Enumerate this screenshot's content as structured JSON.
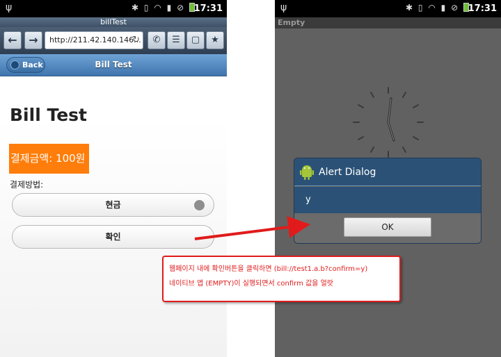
{
  "left_phone": {
    "status": {
      "time": "17:31"
    },
    "window_title": "billTest",
    "browser": {
      "url": "http://211.42.140.146..."
    },
    "header": {
      "back_label": "Back",
      "title": "Bill Test"
    },
    "page": {
      "heading": "Bill Test",
      "amount_label": "결제금액: 100원",
      "method_label": "결제방법:",
      "method_option": "현금",
      "confirm_label": "확인"
    }
  },
  "right_phone": {
    "status": {
      "time": "17:31"
    },
    "app_title": "Empty",
    "dialog": {
      "title": "Alert Dialog",
      "message": "y",
      "ok_label": "OK"
    }
  },
  "annotation": {
    "line1": "웹페이지 내에 확인버튼을 클릭하면 (bill://test1.a.b?confirm=y)",
    "line2": "네이티브 앱 (EMPTY)이 실행되면서 confirm 값을 얼랏"
  },
  "colors": {
    "amount_bg": "#ff7d0a",
    "header_blue": "#3f75ad",
    "dialog_blue": "#2b5176",
    "annotation_red": "#e11b1b"
  }
}
